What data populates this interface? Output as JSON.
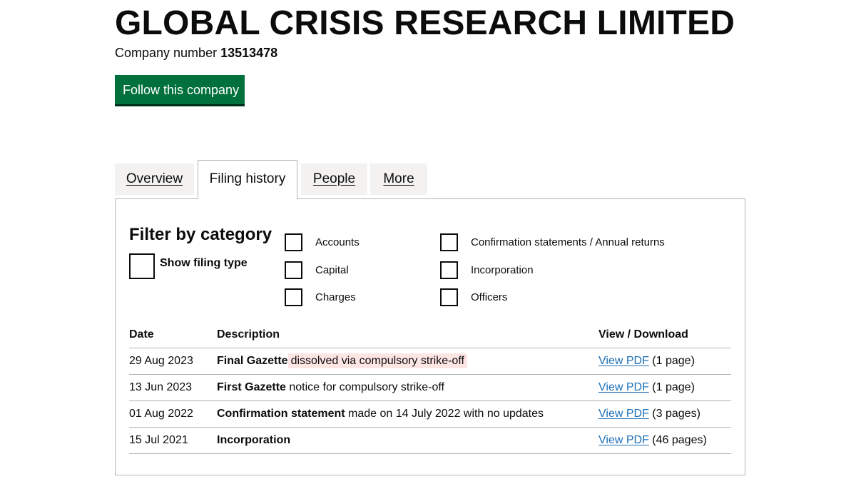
{
  "company": {
    "name": "GLOBAL CRISIS RESEARCH LIMITED",
    "number_label": "Company number",
    "number": "13513478",
    "follow_label": "Follow this company",
    "follow_color": "#00703c"
  },
  "tabs": [
    {
      "label": "Overview",
      "selected": false
    },
    {
      "label": "Filing history",
      "selected": true
    },
    {
      "label": "People",
      "selected": false
    },
    {
      "label": "More",
      "selected": false
    }
  ],
  "filter": {
    "heading": "Filter by category",
    "show_filing_type": "Show filing type",
    "categories": [
      {
        "label": "Accounts",
        "checked": false
      },
      {
        "label": "Capital",
        "checked": false
      },
      {
        "label": "Charges",
        "checked": false
      },
      {
        "label": "Confirmation statements / Annual returns",
        "checked": false
      },
      {
        "label": "Incorporation",
        "checked": false
      },
      {
        "label": "Officers",
        "checked": false
      }
    ]
  },
  "table": {
    "headers": {
      "date": "Date",
      "description": "Description",
      "view": "View / Download"
    },
    "rows": [
      {
        "date": "29 Aug 2023",
        "desc_bold": "Final Gazette",
        "desc_rest": "dissolved via compulsory strike-off",
        "link": "View PDF",
        "pages": "(1 page)"
      },
      {
        "date": "13 Jun 2023",
        "desc_bold": "First Gazette",
        "desc_rest": "notice for compulsory strike-off",
        "link": "View PDF",
        "pages": "(1 page)"
      },
      {
        "date": "01 Aug 2022",
        "desc_bold": "Confirmation statement",
        "desc_rest": "made on 14 July 2022 with no updates",
        "link": "View PDF",
        "pages": "(3 pages)"
      },
      {
        "date": "15 Jul 2021",
        "desc_bold": "Incorporation",
        "desc_rest": "",
        "link": "View PDF",
        "pages": "(46 pages)"
      }
    ]
  },
  "colors": {
    "link": "#1d70b8",
    "highlight": "#fde5e4",
    "tab_background": "#f3f2f1"
  }
}
